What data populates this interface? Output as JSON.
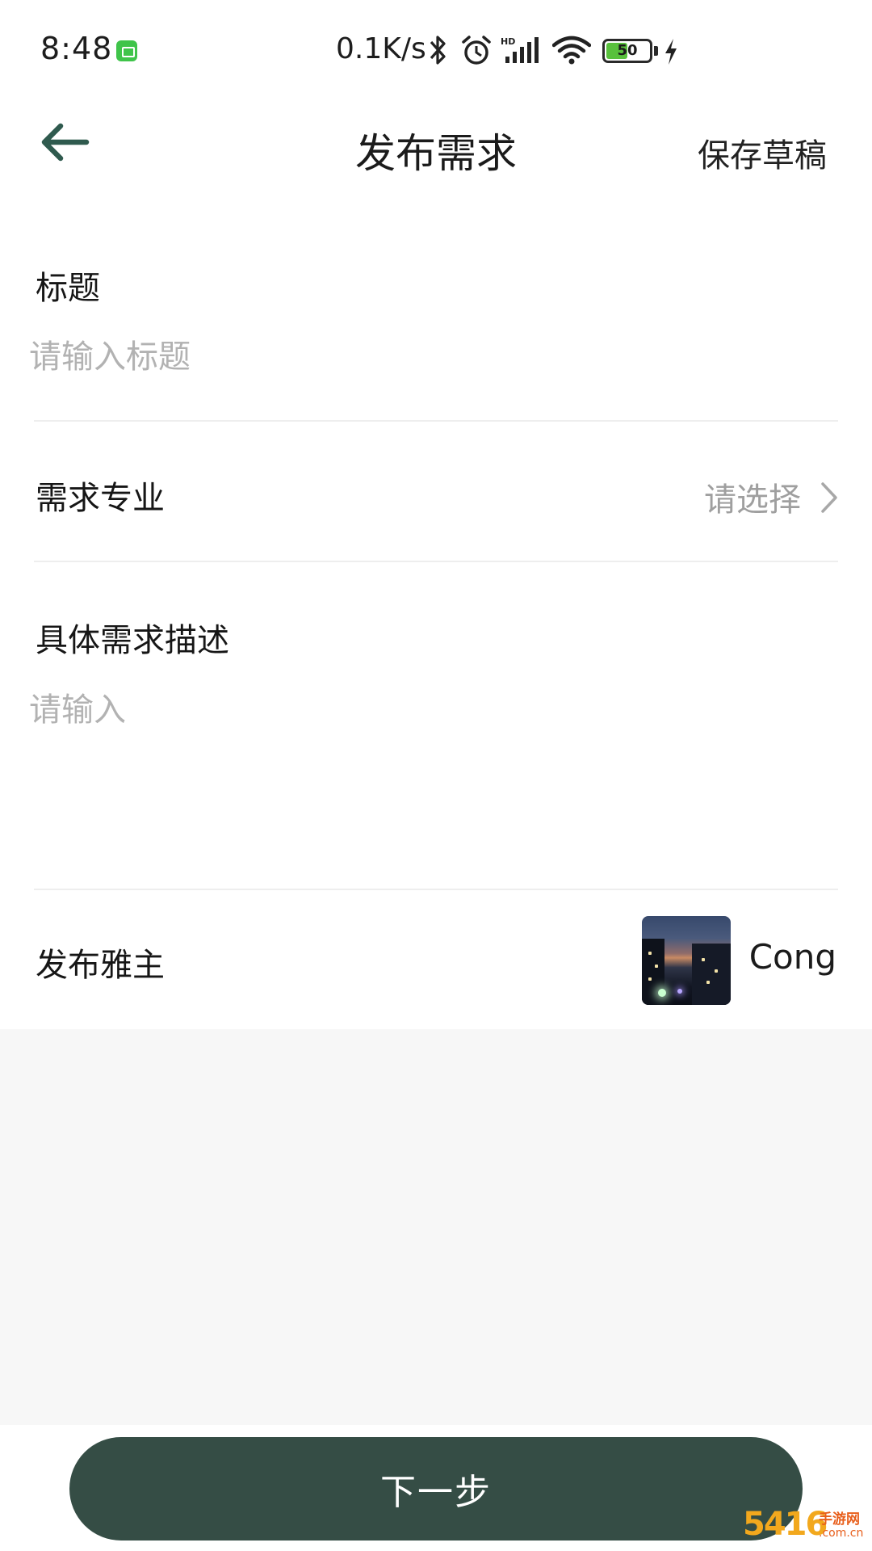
{
  "status_bar": {
    "time": "8:48",
    "net_speed": "0.1K/s",
    "battery_level": 50,
    "battery_text": "50",
    "icons": [
      "notification-app-icon",
      "bluetooth-icon",
      "alarm-icon",
      "hd-signal-icon",
      "wifi-icon",
      "battery-icon",
      "charging-icon"
    ]
  },
  "header": {
    "title": "发布需求",
    "save_draft": "保存草稿",
    "back_icon": "back-arrow-icon"
  },
  "form": {
    "title_label": "标题",
    "title_placeholder": "请输入标题",
    "title_value": "",
    "major_label": "需求专业",
    "major_value": "请选择",
    "description_label": "具体需求描述",
    "description_placeholder": "请输入",
    "description_value": "",
    "publisher_label": "发布雅主",
    "publisher_name": "Cong"
  },
  "actions": {
    "next_label": "下一步"
  },
  "watermark": {
    "number": "5416",
    "cn_text": "手游网",
    "domain": ".com.cn"
  },
  "colors": {
    "accent": "#354d45",
    "placeholder": "#b2b2b2",
    "back_arrow": "#2f5a4e",
    "battery_fill": "#58c13c"
  }
}
